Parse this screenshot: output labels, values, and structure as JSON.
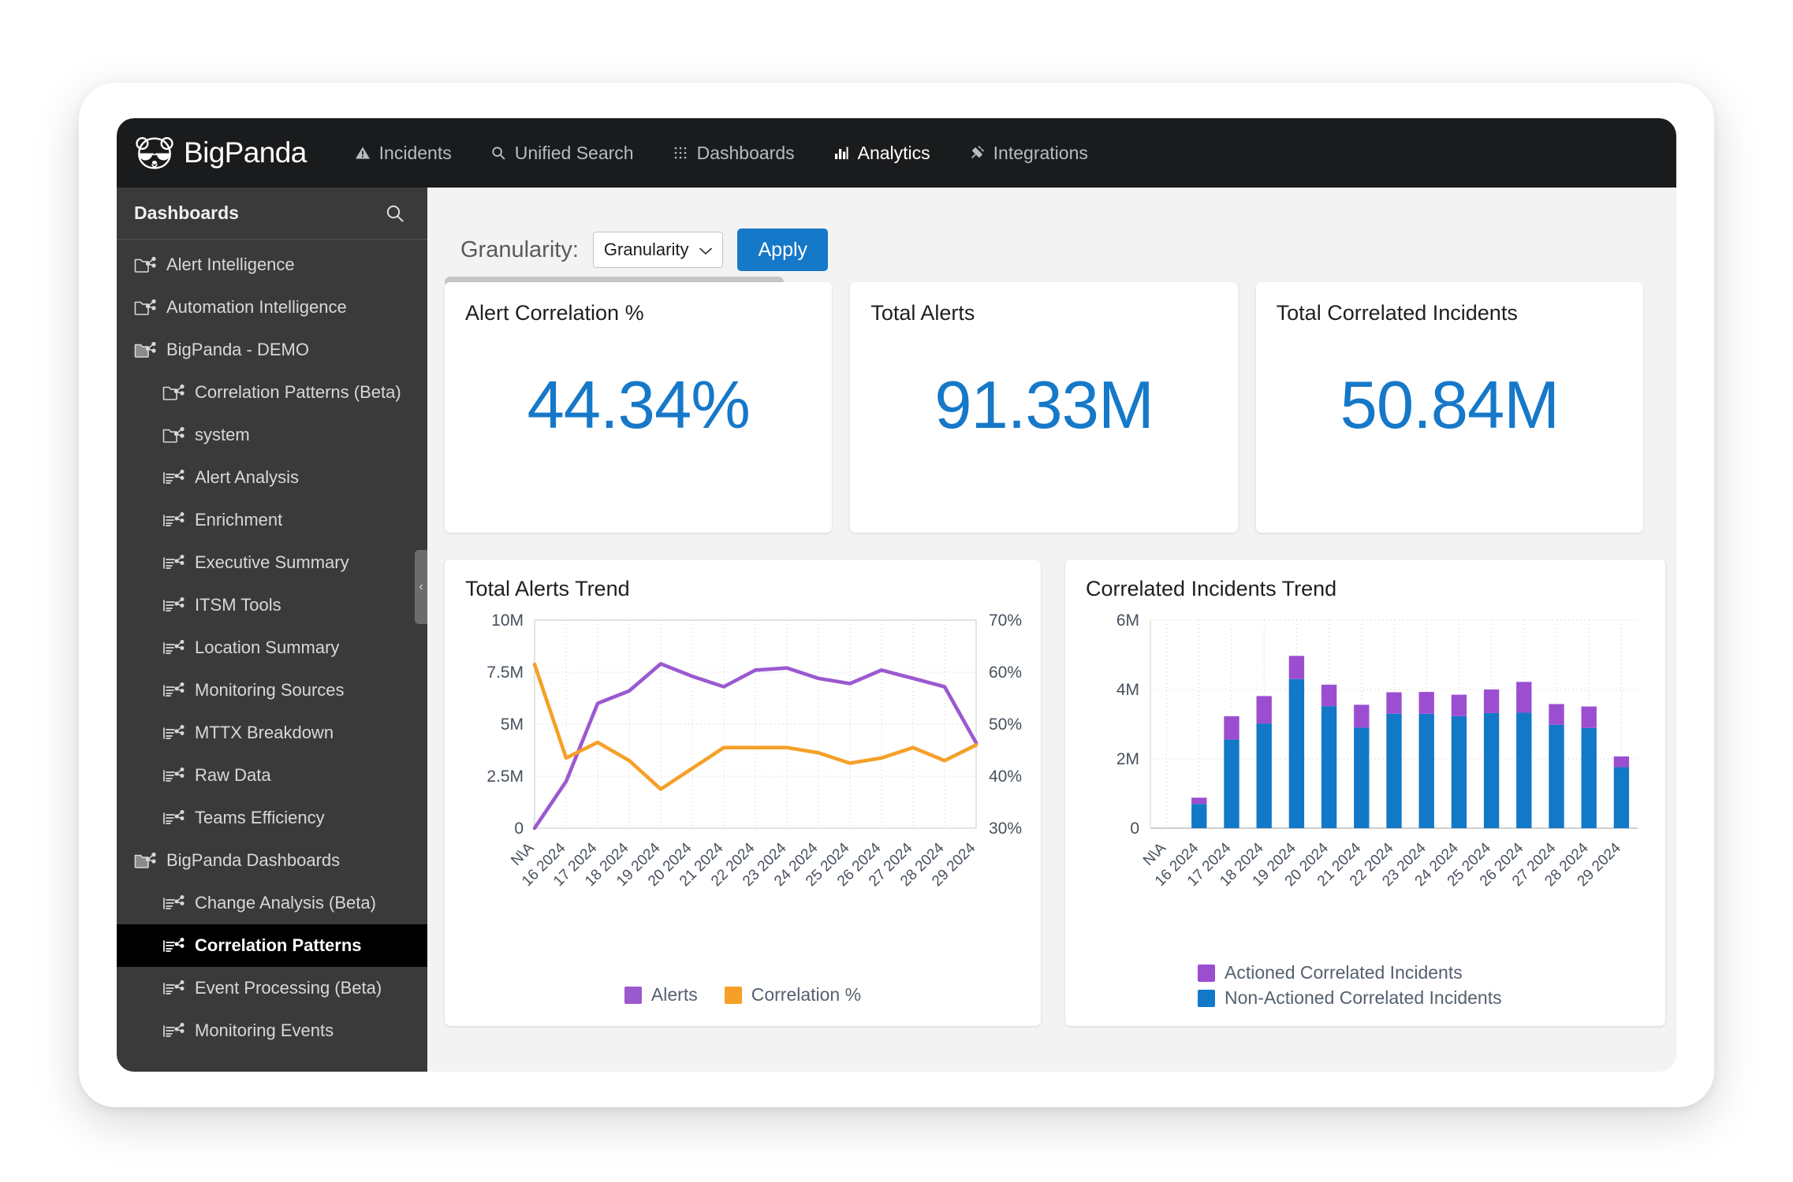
{
  "brand": {
    "name": "BigPanda",
    "logo_icon": "panda-logo-icon"
  },
  "topnav": {
    "items": [
      {
        "label": "Incidents",
        "icon": "warning-triangle-icon",
        "active": false
      },
      {
        "label": "Unified Search",
        "icon": "search-icon",
        "active": false
      },
      {
        "label": "Dashboards",
        "icon": "grid-dots-icon",
        "active": false
      },
      {
        "label": "Analytics",
        "icon": "bar-chart-icon",
        "active": true
      },
      {
        "label": "Integrations",
        "icon": "plug-icon",
        "active": false
      }
    ]
  },
  "sidebar": {
    "title": "Dashboards",
    "search_icon": "search-icon",
    "collapse_icon": "chevron-left-icon",
    "items": [
      {
        "label": "Alert Intelligence",
        "icon": "folder-share-icon",
        "level": 0,
        "selected": false
      },
      {
        "label": "Automation Intelligence",
        "icon": "folder-share-icon",
        "level": 0,
        "selected": false
      },
      {
        "label": "BigPanda - DEMO",
        "icon": "folder-open-share-icon",
        "level": 0,
        "selected": false
      },
      {
        "label": "Correlation Patterns (Beta)",
        "icon": "folder-share-icon",
        "level": 1,
        "selected": false
      },
      {
        "label": "system",
        "icon": "folder-share-icon",
        "level": 1,
        "selected": false
      },
      {
        "label": "Alert Analysis",
        "icon": "dashboard-share-icon",
        "level": 1,
        "selected": false
      },
      {
        "label": "Enrichment",
        "icon": "dashboard-share-icon",
        "level": 1,
        "selected": false
      },
      {
        "label": "Executive Summary",
        "icon": "dashboard-share-icon",
        "level": 1,
        "selected": false
      },
      {
        "label": "ITSM Tools",
        "icon": "dashboard-share-icon",
        "level": 1,
        "selected": false
      },
      {
        "label": "Location Summary",
        "icon": "dashboard-share-icon",
        "level": 1,
        "selected": false
      },
      {
        "label": "Monitoring Sources",
        "icon": "dashboard-share-icon",
        "level": 1,
        "selected": false
      },
      {
        "label": "MTTX Breakdown",
        "icon": "dashboard-share-icon",
        "level": 1,
        "selected": false
      },
      {
        "label": "Raw Data",
        "icon": "dashboard-share-icon",
        "level": 1,
        "selected": false
      },
      {
        "label": "Teams Efficiency",
        "icon": "dashboard-share-icon",
        "level": 1,
        "selected": false
      },
      {
        "label": "BigPanda Dashboards",
        "icon": "folder-open-share-icon",
        "level": 0,
        "selected": false
      },
      {
        "label": "Change Analysis (Beta)",
        "icon": "dashboard-share-icon",
        "level": 1,
        "selected": false
      },
      {
        "label": "Correlation Patterns",
        "icon": "dashboard-share-icon",
        "level": 1,
        "selected": true
      },
      {
        "label": "Event Processing (Beta)",
        "icon": "dashboard-share-icon",
        "level": 1,
        "selected": false
      },
      {
        "label": "Monitoring Events",
        "icon": "dashboard-share-icon",
        "level": 1,
        "selected": false
      }
    ]
  },
  "toolbar": {
    "granularity_label": "Granularity:",
    "granularity_value": "Granularity",
    "apply_label": "Apply",
    "chevron_icon": "chevron-down-icon"
  },
  "kpis": [
    {
      "title": "Alert Correlation %",
      "value": "44.34%"
    },
    {
      "title": "Total Alerts",
      "value": "91.33M"
    },
    {
      "title": "Total Correlated Incidents",
      "value": "50.84M"
    }
  ],
  "colors": {
    "accent_blue": "#1678c8",
    "purple": "#9b59d0",
    "orange": "#f5a028",
    "bar_blue": "#1278c8",
    "bar_purple": "#9b4fd0",
    "nav_dark": "#191b1d",
    "sidebar": "#3a3a3a"
  },
  "chart_data": [
    {
      "type": "line",
      "title": "Total Alerts Trend",
      "xlabel": "",
      "ylabel": "",
      "grid": true,
      "legend_position": "bottom-center",
      "categories": [
        "N\\A",
        "16 2024",
        "17 2024",
        "18 2024",
        "19 2024",
        "20 2024",
        "21 2024",
        "22 2024",
        "23 2024",
        "24 2024",
        "25 2024",
        "26 2024",
        "27 2024",
        "28 2024",
        "29 2024"
      ],
      "axes": {
        "left": {
          "label": "Alerts",
          "ticks": [
            "0",
            "2.5M",
            "5M",
            "7.5M",
            "10M"
          ],
          "min": 0,
          "max": 10000000
        },
        "right": {
          "label": "Correlation %",
          "ticks": [
            "30%",
            "40%",
            "50%",
            "60%",
            "70%"
          ],
          "min": 30,
          "max": 70
        }
      },
      "series": [
        {
          "name": "Alerts",
          "axis": "left",
          "color": "#9b59d0",
          "values": [
            0,
            2250000,
            6000000,
            6600000,
            7900000,
            7300000,
            6800000,
            7600000,
            7700000,
            7200000,
            6950000,
            7600000,
            7200000,
            6800000,
            4100000
          ]
        },
        {
          "name": "Correlation %",
          "axis": "right",
          "color": "#f5a028",
          "values": [
            61.5,
            43.5,
            46.5,
            43.0,
            37.5,
            41.5,
            45.5,
            45.5,
            45.5,
            44.5,
            42.5,
            43.5,
            45.5,
            43.0,
            46.0
          ]
        }
      ]
    },
    {
      "type": "bar",
      "stacked": true,
      "title": "Correlated Incidents Trend",
      "xlabel": "",
      "ylabel": "",
      "grid": true,
      "legend_position": "bottom-left",
      "categories": [
        "N\\A",
        "16 2024",
        "17 2024",
        "18 2024",
        "19 2024",
        "20 2024",
        "21 2024",
        "22 2024",
        "23 2024",
        "24 2024",
        "25 2024",
        "26 2024",
        "27 2024",
        "28 2024",
        "29 2024"
      ],
      "axes": {
        "left": {
          "ticks": [
            "0",
            "2M",
            "4M",
            "6M"
          ],
          "min": 0,
          "max": 6000000
        }
      },
      "series": [
        {
          "name": "Non-Actioned Correlated Incidents",
          "color": "#1278c8",
          "values": [
            0,
            700000,
            2560000,
            3020000,
            4300000,
            3520000,
            2900000,
            3300000,
            3300000,
            3230000,
            3320000,
            3330000,
            2980000,
            2890000,
            1760000
          ]
        },
        {
          "name": "Actioned Correlated Incidents",
          "color": "#9b4fd0",
          "values": [
            0,
            180000,
            670000,
            790000,
            670000,
            620000,
            660000,
            620000,
            630000,
            620000,
            680000,
            890000,
            600000,
            620000,
            310000
          ]
        }
      ]
    }
  ]
}
